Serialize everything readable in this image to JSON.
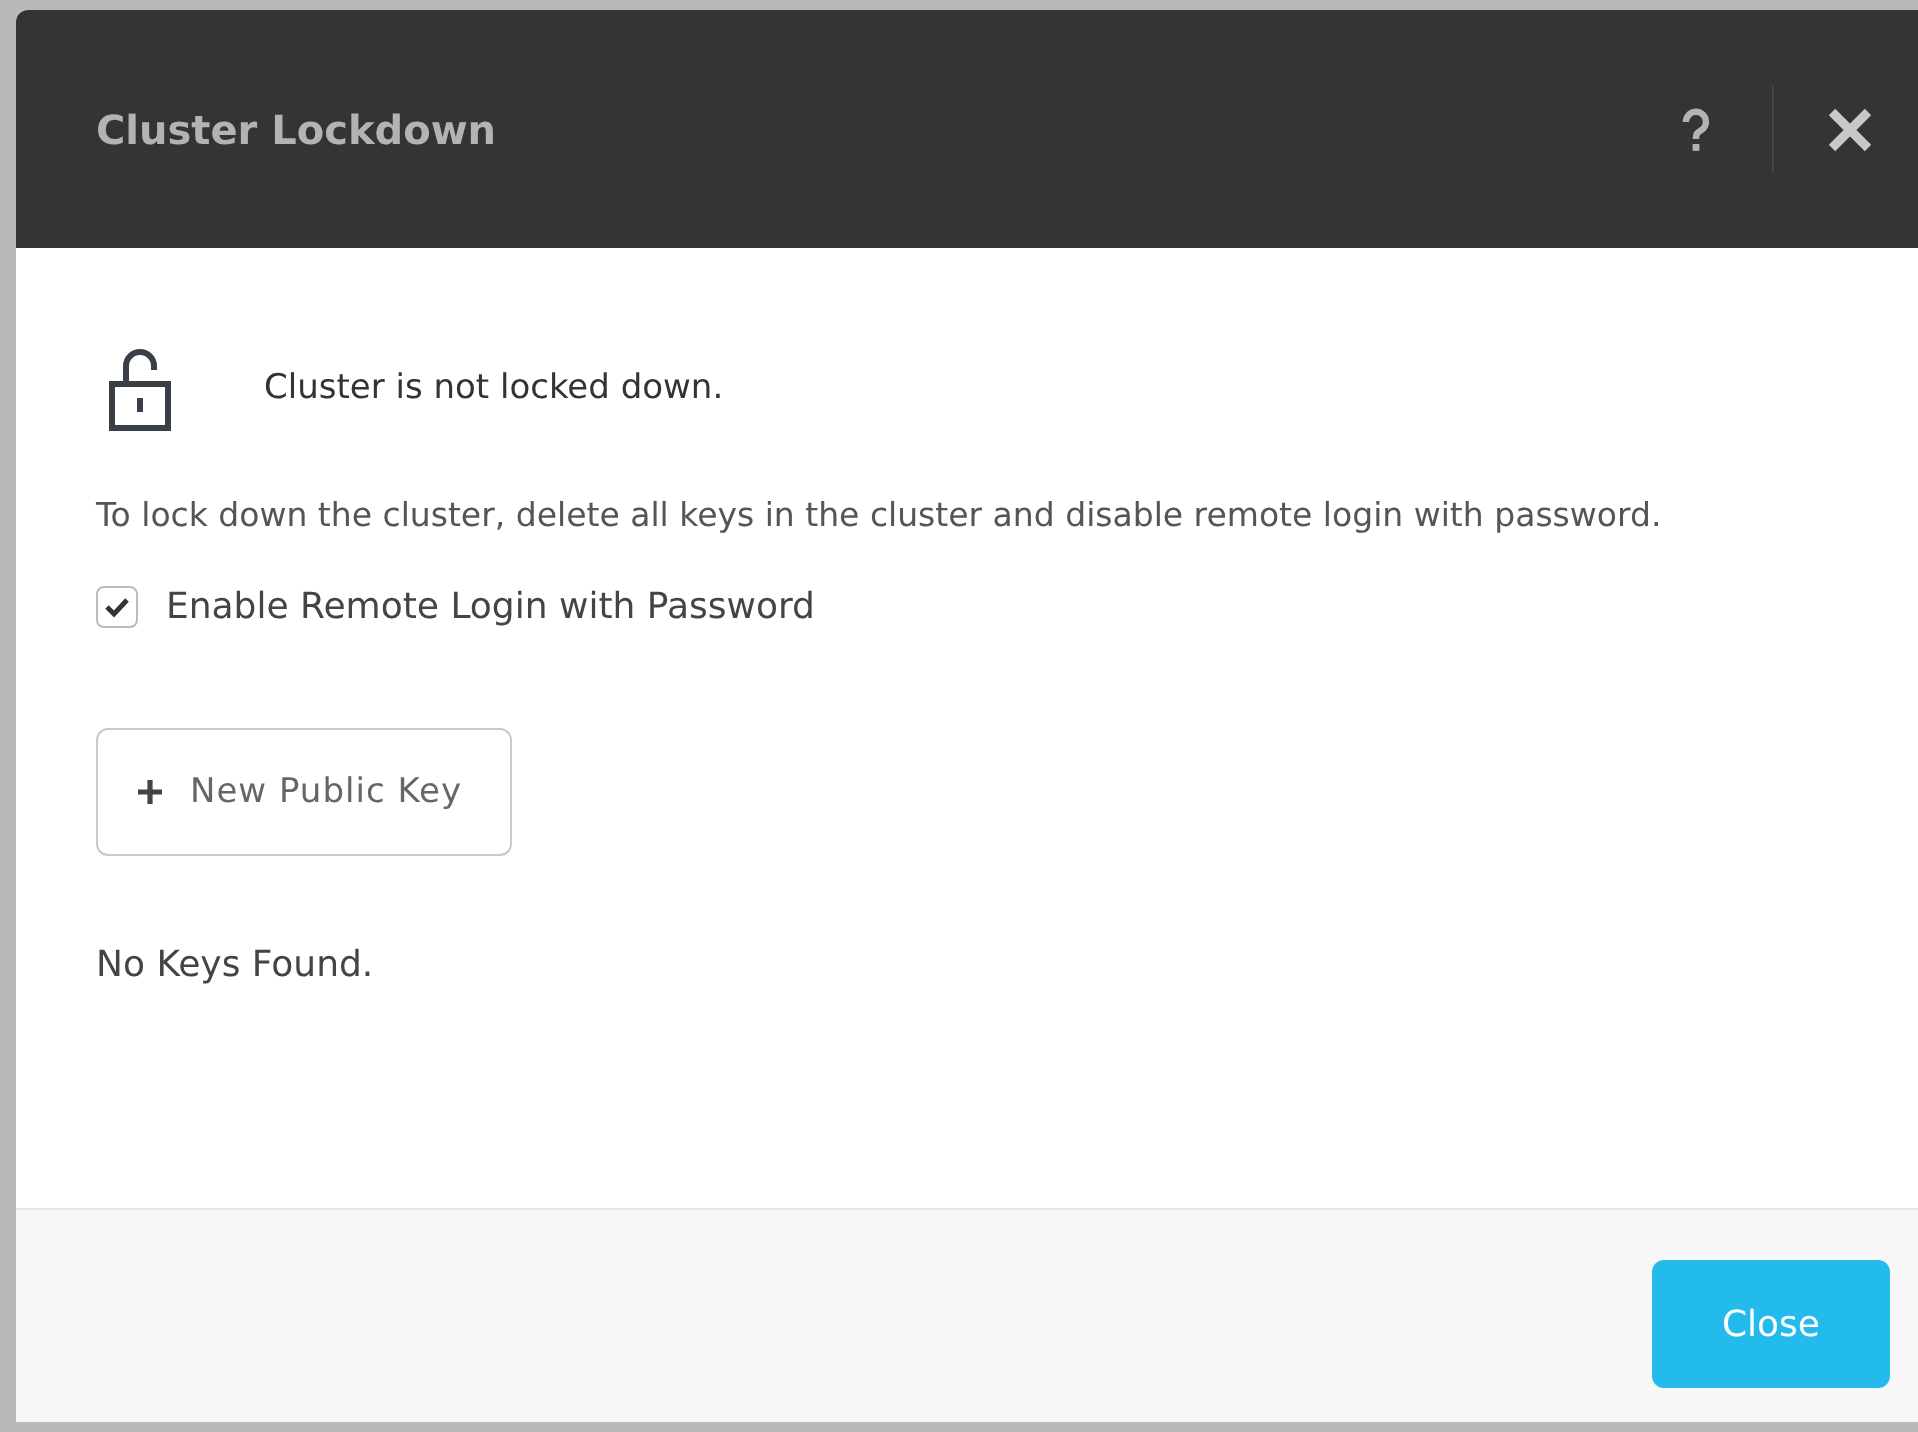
{
  "dialog": {
    "title": "Cluster Lockdown"
  },
  "status": {
    "locked": false,
    "text": "Cluster is not locked down."
  },
  "description": "To lock down the cluster, delete all keys in the cluster and disable remote login with password.",
  "remote_login": {
    "label": "Enable Remote Login with Password",
    "checked": true
  },
  "new_key_button": "New Public Key",
  "keys_message": "No Keys Found.",
  "footer": {
    "close_button": "Close"
  }
}
